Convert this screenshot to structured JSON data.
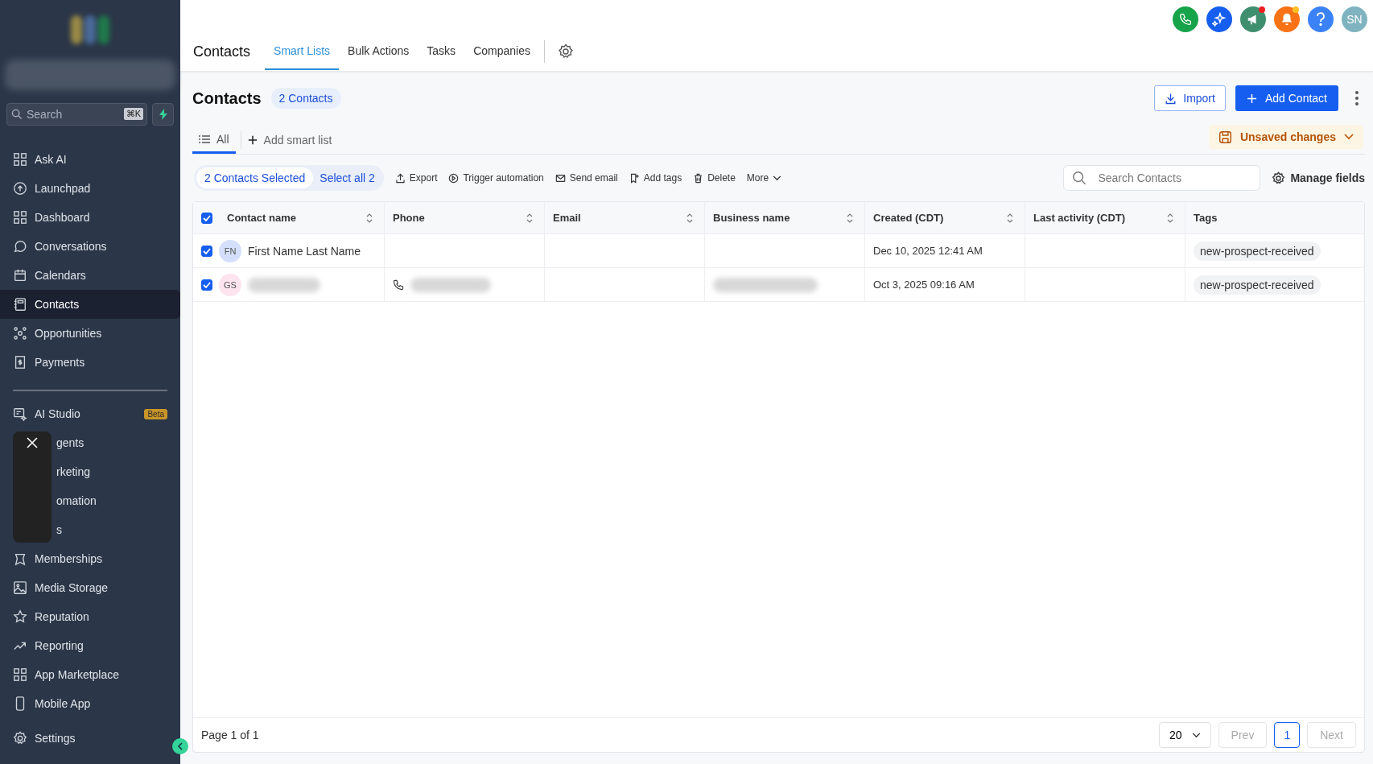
{
  "sidebar": {
    "search": {
      "placeholder": "Search",
      "shortcut": "⌘K"
    },
    "items": [
      {
        "label": "Ask AI",
        "selected": false
      },
      {
        "label": "Launchpad",
        "selected": false
      },
      {
        "label": "Dashboard",
        "selected": false
      },
      {
        "label": "Conversations",
        "selected": false
      },
      {
        "label": "Calendars",
        "selected": false
      },
      {
        "label": "Contacts",
        "selected": true
      },
      {
        "label": "Opportunities",
        "selected": false
      },
      {
        "label": "Payments",
        "selected": false
      }
    ],
    "ai_studio": {
      "label": "AI Studio",
      "badge": "Beta"
    },
    "covered_items": [
      "gents",
      "rketing",
      "omation",
      "s"
    ],
    "items_2": [
      "Memberships",
      "Media Storage",
      "Reputation",
      "Reporting",
      "App Marketplace",
      "Mobile App"
    ],
    "settings": "Settings"
  },
  "top_bar": {
    "title": "Contacts",
    "tabs": [
      {
        "label": "Smart Lists",
        "selected": true
      },
      {
        "label": "Bulk Actions",
        "selected": false
      },
      {
        "label": "Tasks",
        "selected": false
      },
      {
        "label": "Companies",
        "selected": false
      }
    ],
    "icons": [
      {
        "kind": "phone",
        "color": "#16a34a",
        "dot": false
      },
      {
        "kind": "sparkle",
        "color": "#155eef",
        "dot": false
      },
      {
        "kind": "megaphone",
        "color": "#3f8f6f",
        "dot": true
      },
      {
        "kind": "bell",
        "color": "#f97316",
        "dot": true
      },
      {
        "kind": "help",
        "color": "#3b82f6",
        "dot": false
      },
      {
        "kind": "avatar",
        "color": "#7fb3bf",
        "dot": false,
        "text": "SN"
      }
    ]
  },
  "header": {
    "title": "Contacts",
    "count": "2 Contacts",
    "import": "Import",
    "add": "Add Contact"
  },
  "list_tabs": [
    {
      "label": "All",
      "selected": true
    }
  ],
  "add_smart_list": "Add smart list",
  "unsaved": "Unsaved changes",
  "selection": {
    "selected": "2 Contacts Selected",
    "select_all": "Select all 2"
  },
  "actions": [
    {
      "label": "Export",
      "kind": "export"
    },
    {
      "label": "Trigger automation",
      "kind": "play"
    },
    {
      "label": "Send email",
      "kind": "mail"
    },
    {
      "label": "Add tags",
      "kind": "tag"
    },
    {
      "label": "Delete",
      "kind": "trash"
    },
    {
      "label": "More",
      "kind": "more"
    }
  ],
  "search": {
    "placeholder": "Search Contacts"
  },
  "manage_fields": "Manage fields",
  "table": {
    "all_checked": true,
    "columns": [
      "Contact name",
      "Phone",
      "Email",
      "Business name",
      "Created (CDT)",
      "Last activity (CDT)",
      "Tags"
    ],
    "rows": [
      {
        "checked": true,
        "initials": "FN",
        "color": "#d4e0fb",
        "blurred": false,
        "name": "First Name Last Name",
        "created": "Dec 10, 2025 12:41 AM",
        "tag": "new-prospect-received"
      },
      {
        "checked": true,
        "initials": "GS",
        "color": "#fde4ee",
        "blurred": true,
        "created": "Oct 3, 2025 09:16 AM",
        "tag": "new-prospect-received"
      }
    ]
  },
  "pagination": {
    "info": "Page 1 of 1",
    "page_size": "20",
    "prev": "Prev",
    "page": "1",
    "next": "Next"
  }
}
